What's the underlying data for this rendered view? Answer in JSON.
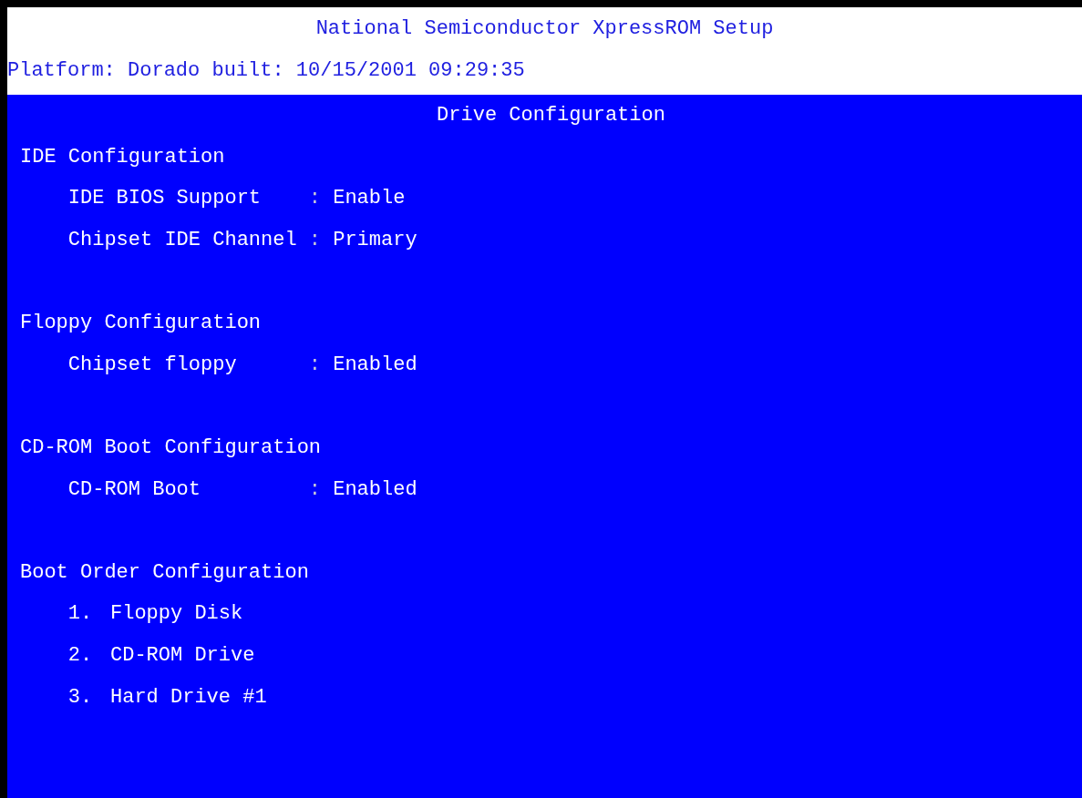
{
  "header": {
    "title": "National Semiconductor XpressROM Setup",
    "build_line": "Platform: Dorado built: 10/15/2001 09:29:35"
  },
  "screen_title": "Drive Configuration",
  "sections": [
    {
      "heading": "IDE Configuration",
      "items": [
        {
          "kind": "setting",
          "label": "IDE BIOS Support",
          "separator": ":",
          "value": "Enable"
        },
        {
          "kind": "setting",
          "label": "Chipset IDE Channel",
          "separator": ":",
          "value": "Primary"
        }
      ]
    },
    {
      "heading": "Floppy Configuration",
      "items": [
        {
          "kind": "setting",
          "label": "Chipset floppy",
          "separator": ":",
          "value": "Enabled"
        }
      ]
    },
    {
      "heading": "CD-ROM Boot Configuration",
      "items": [
        {
          "kind": "setting",
          "label": "CD-ROM Boot",
          "separator": ":",
          "value": "Enabled"
        }
      ]
    },
    {
      "heading": "Boot Order Configuration",
      "items": [
        {
          "kind": "order",
          "number": "1.",
          "label": "Floppy Disk"
        },
        {
          "kind": "order",
          "number": "2.",
          "label": "CD-ROM Drive"
        },
        {
          "kind": "order",
          "number": "3.",
          "label": "Hard Drive #1"
        }
      ]
    }
  ]
}
